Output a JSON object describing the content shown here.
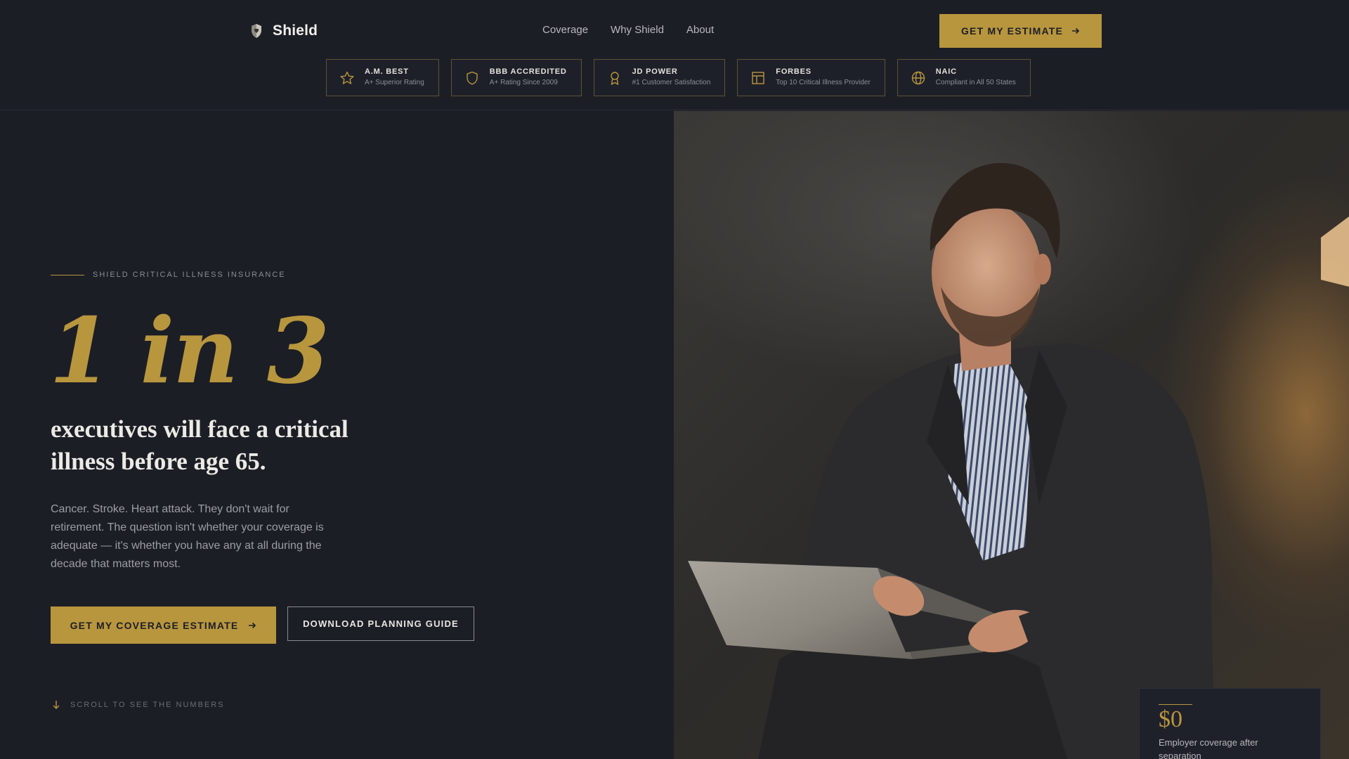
{
  "brand": {
    "name": "Shield",
    "icon": "shield-crest-icon"
  },
  "nav": {
    "items": [
      "Coverage",
      "Why Shield",
      "About"
    ]
  },
  "header_cta": {
    "label": "GET MY ESTIMATE",
    "icon": "arrow-right-icon"
  },
  "badges": [
    {
      "title": "A.M. BEST",
      "subtitle": "A+ Superior Rating",
      "icon": "star-icon"
    },
    {
      "title": "BBB ACCREDITED",
      "subtitle": "A+ Rating Since 2009",
      "icon": "shield-icon"
    },
    {
      "title": "JD POWER",
      "subtitle": "#1 Customer Satisfaction",
      "icon": "award-icon"
    },
    {
      "title": "FORBES",
      "subtitle": "Top 10 Critical Illness Provider",
      "icon": "layout-icon"
    },
    {
      "title": "NAIC",
      "subtitle": "Compliant in All 50 States",
      "icon": "globe-icon"
    }
  ],
  "hero": {
    "eyebrow": "SHIELD CRITICAL ILLNESS INSURANCE",
    "headline": "1 in 3",
    "subheadline": "executives will face a critical illness before age 65.",
    "body": "Cancer. Stroke. Heart attack. They don't wait for retirement. The question isn't whether your coverage is adequate — it's whether you have any at all during the decade that matters most.",
    "primary_cta": "GET MY COVERAGE ESTIMATE",
    "secondary_cta": "DOWNLOAD PLANNING GUIDE",
    "scroll_hint": "SCROLL TO SEE THE NUMBERS"
  },
  "stat_card": {
    "value": "$0",
    "label": "Employer coverage after separation"
  },
  "colors": {
    "background": "#1c1e26",
    "accent": "#b8963e",
    "text": "#e8e6e1",
    "muted": "#9c9ea4"
  }
}
